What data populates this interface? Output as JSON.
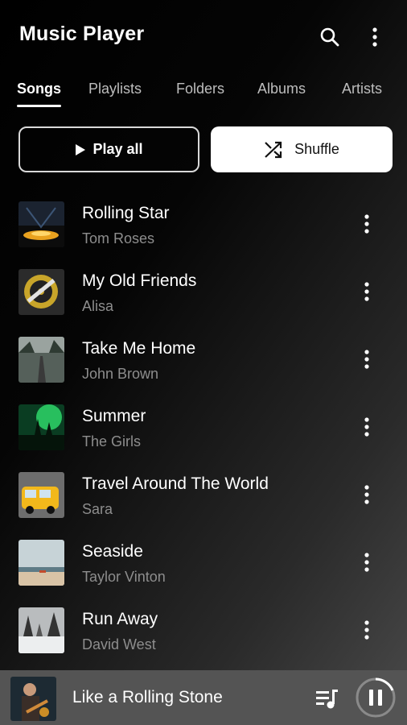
{
  "header": {
    "title": "Music Player",
    "search_icon": "search-icon",
    "more_icon": "more-vert-icon"
  },
  "tabs": [
    {
      "label": "Songs",
      "active": true
    },
    {
      "label": "Playlists",
      "active": false
    },
    {
      "label": "Folders",
      "active": false
    },
    {
      "label": "Albums",
      "active": false
    },
    {
      "label": "Artists",
      "active": false
    }
  ],
  "actions": {
    "play_all": "Play all",
    "shuffle": "Shuffle"
  },
  "songs": [
    {
      "title": "Rolling Star",
      "artist": "Tom Roses",
      "art": "concert-stage"
    },
    {
      "title": "My Old Friends",
      "artist": "Alisa",
      "art": "vinyl-record"
    },
    {
      "title": "Take Me Home",
      "artist": "John Brown",
      "art": "forest-road"
    },
    {
      "title": "Summer",
      "artist": "The Girls",
      "art": "green-concert"
    },
    {
      "title": "Travel Around The World",
      "artist": "Sara",
      "art": "yellow-van"
    },
    {
      "title": "Seaside",
      "artist": "Taylor Vinton",
      "art": "beach"
    },
    {
      "title": "Run Away",
      "artist": "David West",
      "art": "snowy-trees"
    }
  ],
  "now_playing": {
    "title": "Like a Rolling Stone",
    "state": "playing"
  },
  "colors": {
    "accent": "#ffffff",
    "secondary_text": "#8d8d8d",
    "player_bar": "#545454"
  }
}
